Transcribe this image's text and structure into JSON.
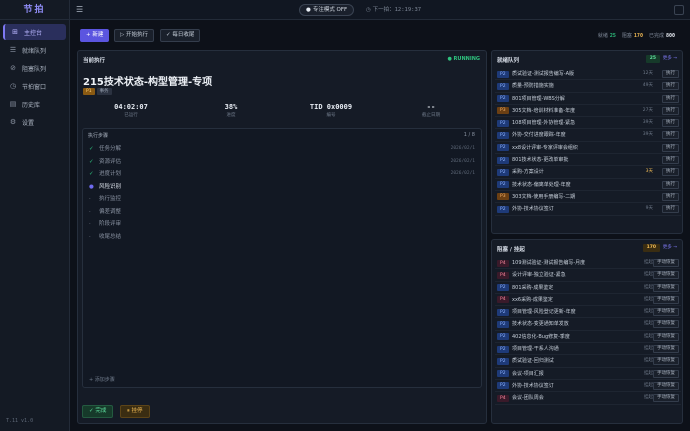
{
  "app": {
    "logo": "节拍",
    "version": "T.11 v1.0"
  },
  "sidebar": {
    "items": [
      {
        "icon": "dashboard-icon",
        "glyph": "⊞",
        "label": "主控台",
        "active": true
      },
      {
        "icon": "list-icon",
        "glyph": "☰",
        "label": "就绪队列"
      },
      {
        "icon": "block-icon",
        "glyph": "⊘",
        "label": "阻塞队列"
      },
      {
        "icon": "clock-icon",
        "glyph": "◷",
        "label": "节拍窗口"
      },
      {
        "icon": "archive-icon",
        "glyph": "▤",
        "label": "历史库"
      },
      {
        "icon": "gear-icon",
        "glyph": "⚙",
        "label": "设置"
      }
    ]
  },
  "topbar": {
    "focus_mode": "专注模式 OFF",
    "next_label": "下一拍",
    "next_time": "12:19:37"
  },
  "toolbar": {
    "new_label": "+ 新建",
    "start_label": "▷ 开始执行",
    "collect_label": "✓ 每日收尾",
    "stats": [
      {
        "label": "就绪",
        "value": "25",
        "color": "#2ec27e"
      },
      {
        "label": "阻塞",
        "value": "170",
        "color": "#f3bc55"
      },
      {
        "label": "已完成",
        "value": "800",
        "color": "#e7ecf3"
      }
    ]
  },
  "current": {
    "panel_title": "当前执行",
    "status": "● RUNNING",
    "task_title": "215技术状态-构型管理-专项",
    "priority": "P1",
    "category": "事务",
    "metrics": [
      {
        "value": "04:02:07",
        "label": "已运行"
      },
      {
        "value": "38%",
        "label": "进度"
      },
      {
        "value": "TID 0x0009",
        "label": "编号"
      },
      {
        "value": "--",
        "label": "截止日期"
      }
    ],
    "steps_title": "执行步骤",
    "steps_count": "1 / 8",
    "steps": [
      {
        "label": "任务分解",
        "state": "done",
        "time": "2026/02/1"
      },
      {
        "label": "资源评估",
        "state": "done",
        "time": "2026/02/1"
      },
      {
        "label": "进度计划",
        "state": "done",
        "time": "2026/02/1"
      },
      {
        "label": "风险识别",
        "state": "active",
        "time": ""
      },
      {
        "label": "执行监控",
        "state": "todo",
        "time": ""
      },
      {
        "label": "偏差调整",
        "state": "todo",
        "time": ""
      },
      {
        "label": "阶段评审",
        "state": "todo",
        "time": ""
      },
      {
        "label": "收尾总结",
        "state": "todo",
        "time": ""
      }
    ],
    "add_step": "+ 添加步骤",
    "complete_label": "✓ 完成",
    "pause_label": "⏸ 挂停"
  },
  "ready": {
    "title": "就绪队列",
    "count": "25",
    "more": "更多 →",
    "rows": [
      {
        "tag": "P2",
        "name": "质试验证-测试报告编写-A版",
        "meta": "12天",
        "action": "执行"
      },
      {
        "tag": "P2",
        "name": "质量-预防措施实施",
        "meta": "49天",
        "action": "执行"
      },
      {
        "tag": "P2",
        "name": "801项目管理-WBS分解",
        "meta": "",
        "action": "执行"
      },
      {
        "tag": "P3",
        "name": "305文档-培训材料准备-年度",
        "meta": "27天",
        "action": "执行"
      },
      {
        "tag": "P2",
        "name": "108项目管理-外协管理-紧急",
        "meta": "39天",
        "action": "执行"
      },
      {
        "tag": "P2",
        "name": "外协-交付进度跟踪-年度",
        "meta": "39天",
        "action": "执行"
      },
      {
        "tag": "P2",
        "name": "xx8设计评审-专家评审会组织",
        "meta": "",
        "action": "执行"
      },
      {
        "tag": "P2",
        "name": "801技术状态-更改单审批",
        "meta": "",
        "action": "执行"
      },
      {
        "tag": "P2",
        "name": "采购-方案设计",
        "meta": "3天",
        "hi": true,
        "action": "执行"
      },
      {
        "tag": "P2",
        "name": "技术状态-偏离单处理-年度",
        "meta": "",
        "action": "执行"
      },
      {
        "tag": "P3",
        "name": "303文档-使用手册编写-二期",
        "meta": "",
        "action": "执行"
      },
      {
        "tag": "P2",
        "name": "外协-技术协议签订",
        "meta": "9天",
        "action": "执行"
      }
    ]
  },
  "blocked": {
    "title": "阻塞 / 挂起",
    "count": "170",
    "more": "更多 →",
    "rows": [
      {
        "tag": "P4",
        "name": "109测试验证-测试报告编写-月度",
        "meta": "挂起",
        "action": "手动恢复"
      },
      {
        "tag": "P4",
        "name": "设计评审-独立验证-紧急",
        "meta": "挂起",
        "action": "手动恢复"
      },
      {
        "tag": "P2",
        "name": "801采购-成果鉴定",
        "meta": "挂起",
        "action": "手动恢复"
      },
      {
        "tag": "P4",
        "name": "xx6采购-成果鉴定",
        "meta": "挂起",
        "action": "手动恢复"
      },
      {
        "tag": "P2",
        "name": "项目管理-风险登记更新-年度",
        "meta": "挂起",
        "action": "手动恢复"
      },
      {
        "tag": "P2",
        "name": "技术状态-变更通知单发放",
        "meta": "挂起",
        "action": "手动恢复"
      },
      {
        "tag": "P2",
        "name": "402信息化-Bug修复-季度",
        "meta": "挂起",
        "action": "手动恢复"
      },
      {
        "tag": "P2",
        "name": "项目管理-干系人沟通",
        "meta": "挂起",
        "action": "手动恢复"
      },
      {
        "tag": "P2",
        "name": "质试验证-回归测试",
        "meta": "挂起",
        "action": "手动恢复"
      },
      {
        "tag": "P2",
        "name": "会议-项目汇报",
        "meta": "挂起",
        "action": "手动恢复"
      },
      {
        "tag": "P2",
        "name": "外协-技术协议签订",
        "meta": "挂起",
        "action": "手动恢复"
      },
      {
        "tag": "P4",
        "name": "会议-团队周会",
        "meta": "挂起",
        "action": "手动恢复"
      }
    ]
  }
}
